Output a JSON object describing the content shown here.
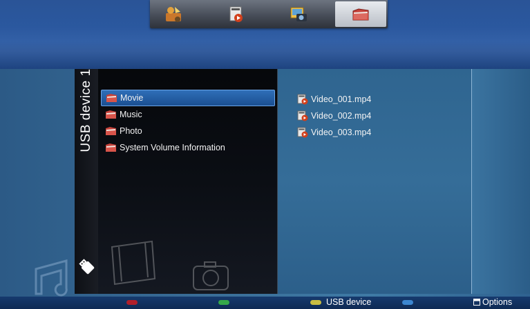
{
  "tabs": [
    {
      "icon": "apps-icon",
      "selected": false
    },
    {
      "icon": "video-icon",
      "selected": false
    },
    {
      "icon": "photo-icon",
      "selected": false
    },
    {
      "icon": "folder-icon",
      "selected": true
    }
  ],
  "device": {
    "title": "USB device 1",
    "icon": "usb-stick-icon"
  },
  "folders": [
    {
      "label": "Movie",
      "selected": true
    },
    {
      "label": "Music",
      "selected": false
    },
    {
      "label": "Photo",
      "selected": false
    },
    {
      "label": "System Volume Information",
      "selected": false
    }
  ],
  "files": [
    {
      "label": "Video_001.mp4"
    },
    {
      "label": "Video_002.mp4"
    },
    {
      "label": "Video_003.mp4"
    }
  ],
  "bottom": {
    "keys": [
      {
        "color": "#b01f2b",
        "label": ""
      },
      {
        "color": "#35a84a",
        "label": ""
      },
      {
        "color": "#c8bd42",
        "label": "USB device"
      },
      {
        "color": "#3b86d0",
        "label": ""
      }
    ],
    "options_label": "Options"
  }
}
